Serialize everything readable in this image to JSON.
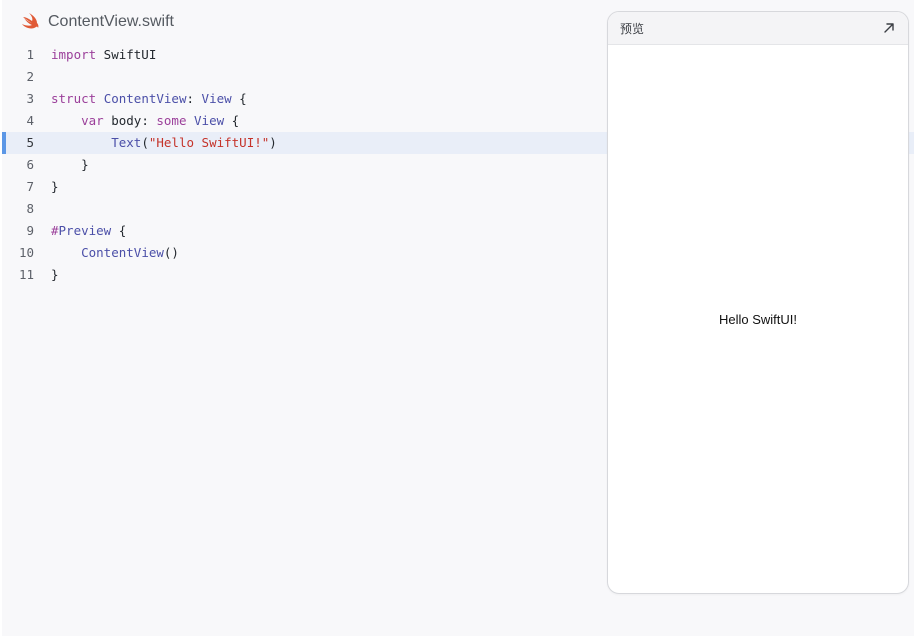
{
  "file": {
    "name": "ContentView.swift",
    "icon": "swift-icon",
    "accent": "#e05a36"
  },
  "code": {
    "active_line": 5,
    "line_numbers": [
      "1",
      "2",
      "3",
      "4",
      "5",
      "6",
      "7",
      "8",
      "9",
      "10",
      "11"
    ]
  },
  "preview": {
    "title": "预览",
    "expand_icon": "arrow-up-right-icon",
    "text": "Hello SwiftUI!"
  }
}
